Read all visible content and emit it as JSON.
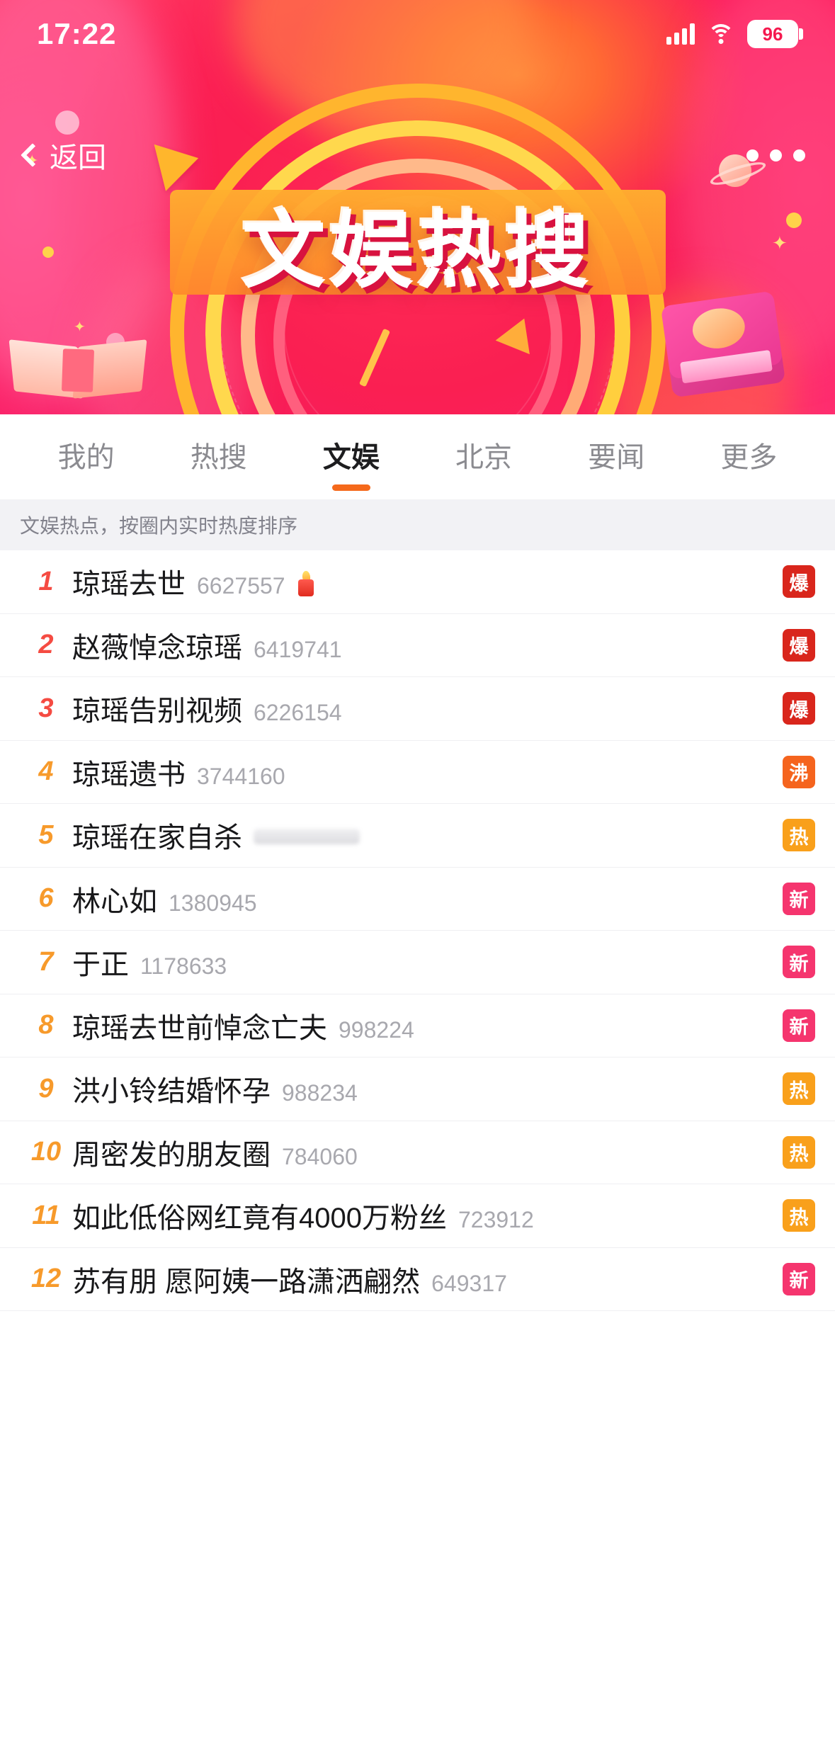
{
  "status_bar": {
    "time": "17:22",
    "battery_level": "96",
    "icons": [
      "signal-icon",
      "wifi-icon",
      "battery-icon"
    ]
  },
  "nav": {
    "back_label": "返回",
    "more_icon": "more-dots-icon"
  },
  "banner": {
    "title": "文娱热搜"
  },
  "tabs": [
    {
      "label": "我的",
      "active": false
    },
    {
      "label": "热搜",
      "active": false
    },
    {
      "label": "文娱",
      "active": true
    },
    {
      "label": "北京",
      "active": false
    },
    {
      "label": "要闻",
      "active": false
    },
    {
      "label": "更多",
      "active": false
    }
  ],
  "subtitle": "文娱热点，按圈内实时热度排序",
  "colors": {
    "accent": "#f5691b",
    "bao": "#d9261c",
    "fei": "#f5641e",
    "re": "#f9a01b",
    "xin": "#f5356e",
    "rank_top3": "#f54b42",
    "rank_mid": "#f79a2b"
  },
  "list": [
    {
      "rank": "1",
      "title": "琼瑶去世",
      "count": "6627557",
      "badge": "爆",
      "badge_type": "bao",
      "emoji": "candle-icon",
      "blurred": false
    },
    {
      "rank": "2",
      "title": "赵薇悼念琼瑶",
      "count": "6419741",
      "badge": "爆",
      "badge_type": "bao",
      "emoji": "",
      "blurred": false
    },
    {
      "rank": "3",
      "title": "琼瑶告别视频",
      "count": "6226154",
      "badge": "爆",
      "badge_type": "bao",
      "emoji": "",
      "blurred": false
    },
    {
      "rank": "4",
      "title": "琼瑶遗书",
      "count": "3744160",
      "badge": "沸",
      "badge_type": "fei",
      "emoji": "",
      "blurred": false
    },
    {
      "rank": "5",
      "title": "琼瑶在家自杀",
      "count": "",
      "badge": "热",
      "badge_type": "re",
      "emoji": "",
      "blurred": true
    },
    {
      "rank": "6",
      "title": "林心如",
      "count": "1380945",
      "badge": "新",
      "badge_type": "xin",
      "emoji": "",
      "blurred": false
    },
    {
      "rank": "7",
      "title": "于正",
      "count": "1178633",
      "badge": "新",
      "badge_type": "xin",
      "emoji": "",
      "blurred": false
    },
    {
      "rank": "8",
      "title": "琼瑶去世前悼念亡夫",
      "count": "998224",
      "badge": "新",
      "badge_type": "xin",
      "emoji": "",
      "blurred": false
    },
    {
      "rank": "9",
      "title": "洪小铃结婚怀孕",
      "count": "988234",
      "badge": "热",
      "badge_type": "re",
      "emoji": "",
      "blurred": false
    },
    {
      "rank": "10",
      "title": "周密发的朋友圈",
      "count": "784060",
      "badge": "热",
      "badge_type": "re",
      "emoji": "",
      "blurred": false
    },
    {
      "rank": "11",
      "title": "如此低俗网红竟有4000万粉丝",
      "count": "723912",
      "badge": "热",
      "badge_type": "re",
      "emoji": "",
      "blurred": false
    },
    {
      "rank": "12",
      "title": "苏有朋 愿阿姨一路潇洒翩然",
      "count": "649317",
      "badge": "新",
      "badge_type": "xin",
      "emoji": "",
      "blurred": false
    }
  ]
}
